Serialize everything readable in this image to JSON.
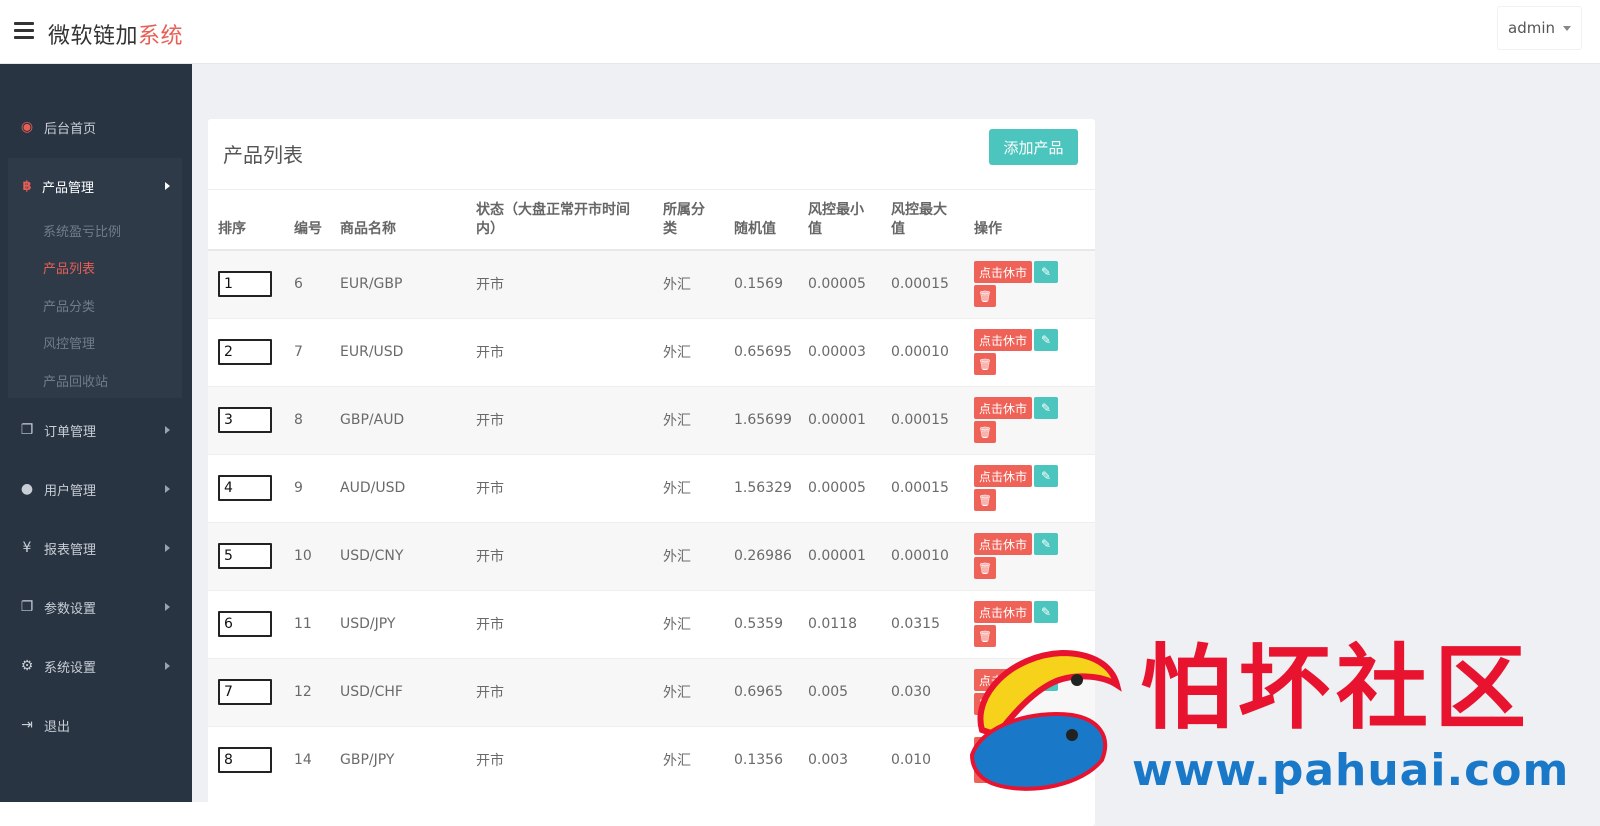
{
  "header": {
    "brand_main": "微软链加",
    "brand_accent": "系统",
    "user": "admin"
  },
  "sidebar": {
    "home": "后台首页",
    "product_group": {
      "label": "产品管理",
      "children": [
        "系统盈亏比例",
        "产品列表",
        "产品分类",
        "风控管理",
        "产品回收站"
      ],
      "active": "产品列表"
    },
    "items": [
      "订单管理",
      "用户管理",
      "报表管理",
      "参数设置",
      "系统设置",
      "退出"
    ]
  },
  "panel": {
    "title": "产品列表",
    "add_button": "添加产品"
  },
  "table": {
    "columns": [
      "排序",
      "编号",
      "商品名称",
      "状态（大盘正常开市时间内）",
      "所属分类",
      "随机值",
      "风控最小值",
      "风控最大值",
      "操作"
    ],
    "rows": [
      {
        "order": "1",
        "id": "6",
        "name": "EUR/GBP",
        "status": "开市",
        "category": "外汇",
        "random": "0.1569",
        "risk_min": "0.00005",
        "risk_max": "0.00015"
      },
      {
        "order": "2",
        "id": "7",
        "name": "EUR/USD",
        "status": "开市",
        "category": "外汇",
        "random": "0.65695",
        "risk_min": "0.00003",
        "risk_max": "0.00010"
      },
      {
        "order": "3",
        "id": "8",
        "name": "GBP/AUD",
        "status": "开市",
        "category": "外汇",
        "random": "1.65699",
        "risk_min": "0.00001",
        "risk_max": "0.00015"
      },
      {
        "order": "4",
        "id": "9",
        "name": "AUD/USD",
        "status": "开市",
        "category": "外汇",
        "random": "1.56329",
        "risk_min": "0.00005",
        "risk_max": "0.00015"
      },
      {
        "order": "5",
        "id": "10",
        "name": "USD/CNY",
        "status": "开市",
        "category": "外汇",
        "random": "0.26986",
        "risk_min": "0.00001",
        "risk_max": "0.00010"
      },
      {
        "order": "6",
        "id": "11",
        "name": "USD/JPY",
        "status": "开市",
        "category": "外汇",
        "random": "0.5359",
        "risk_min": "0.0118",
        "risk_max": "0.0315"
      },
      {
        "order": "7",
        "id": "12",
        "name": "USD/CHF",
        "status": "开市",
        "category": "外汇",
        "random": "0.6965",
        "risk_min": "0.005",
        "risk_max": "0.030"
      },
      {
        "order": "8",
        "id": "14",
        "name": "GBP/JPY",
        "status": "开市",
        "category": "外汇",
        "random": "0.1356",
        "risk_min": "0.003",
        "risk_max": "0.010"
      }
    ],
    "close_label": "点击休市",
    "edit_icon": "✎",
    "delete_icon": "🗑"
  },
  "watermark": {
    "title": "怕坏社区",
    "url": "www.pahuai.com"
  },
  "colors": {
    "accent": "#e85f56",
    "teal": "#4bc5be",
    "sidebar": "#283441"
  }
}
